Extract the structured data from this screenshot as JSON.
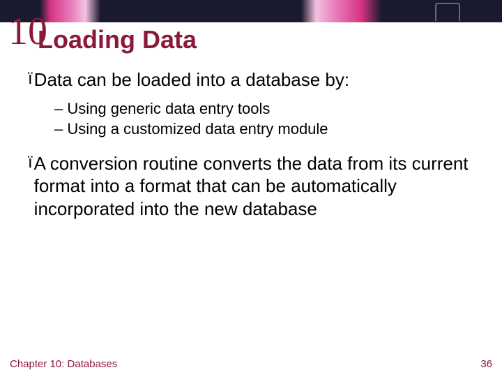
{
  "chapter_number": "10",
  "title": "Loading Data",
  "bullets": [
    {
      "text": "Data can be loaded into a database by:",
      "sub": [
        "– Using generic data entry tools",
        "– Using a customized data entry module"
      ]
    },
    {
      "text": "A conversion routine converts the data from its current format into a format that can be automatically incorporated into the new database",
      "sub": []
    }
  ],
  "footer": {
    "left": "Chapter 10: Databases",
    "right": "36"
  },
  "arrow_glyph": "ï"
}
